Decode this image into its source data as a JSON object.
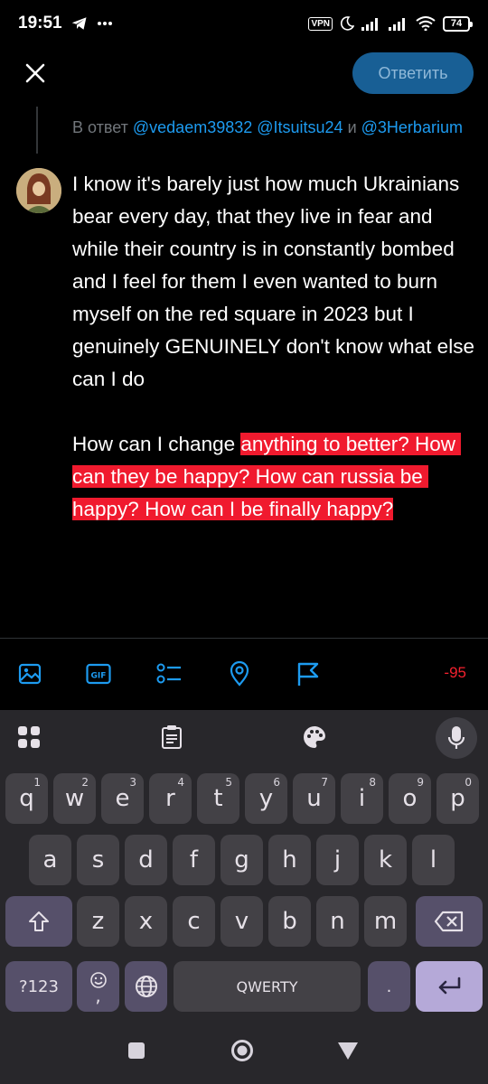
{
  "status_bar": {
    "time": "19:51",
    "vpn": "VPN",
    "battery": "74",
    "left_icons": [
      "telegram-icon",
      "more-dots-icon"
    ],
    "right_icons": [
      "vpn-icon",
      "moon-icon",
      "signal-icon",
      "signal-icon",
      "wifi-icon",
      "battery-icon"
    ]
  },
  "header": {
    "close_icon": "close-icon",
    "reply_button": "Ответить"
  },
  "reply_context": {
    "prefix": "В ответ ",
    "mentions": "@vedaem39832 @Itsuitsu24",
    "conjunction": " и ",
    "mentions2": "@3Herbarium"
  },
  "tweet": {
    "text_part1": "I know it's barely just how much Ukrainians bear every day, that they live in fear and while their country is in constantly bombed and I feel for them I even wanted to burn myself on the red square in 2023 but I genuinely GENUINELY don't know what else can I do\n\nHow can I change ",
    "text_highlighted": "anything to better? How can they be happy? How can russia be happy? How can I be finally happy?"
  },
  "toolbar": {
    "icons": [
      "image-icon",
      "gif-icon",
      "poll-icon",
      "location-icon",
      "flag-icon"
    ],
    "char_count": "-95",
    "accent": "#1d9bf0",
    "error_color": "#f4212e"
  },
  "keyboard": {
    "top_icons": [
      "apps-grid-icon",
      "clipboard-icon",
      "palette-icon",
      "mic-icon"
    ],
    "row1": [
      {
        "k": "q",
        "h": "1"
      },
      {
        "k": "w",
        "h": "2"
      },
      {
        "k": "e",
        "h": "3"
      },
      {
        "k": "r",
        "h": "4"
      },
      {
        "k": "t",
        "h": "5"
      },
      {
        "k": "y",
        "h": "6"
      },
      {
        "k": "u",
        "h": "7"
      },
      {
        "k": "i",
        "h": "8"
      },
      {
        "k": "o",
        "h": "9"
      },
      {
        "k": "p",
        "h": "0"
      }
    ],
    "row2": [
      "a",
      "s",
      "d",
      "f",
      "g",
      "h",
      "j",
      "k",
      "l"
    ],
    "row3": [
      "z",
      "x",
      "c",
      "v",
      "b",
      "n",
      "m"
    ],
    "symbols": "?123",
    "emoji_comma": ",",
    "space": "QWERTY",
    "period": "."
  },
  "navbar": {
    "icons": [
      "recents-icon",
      "home-icon",
      "back-icon"
    ]
  }
}
